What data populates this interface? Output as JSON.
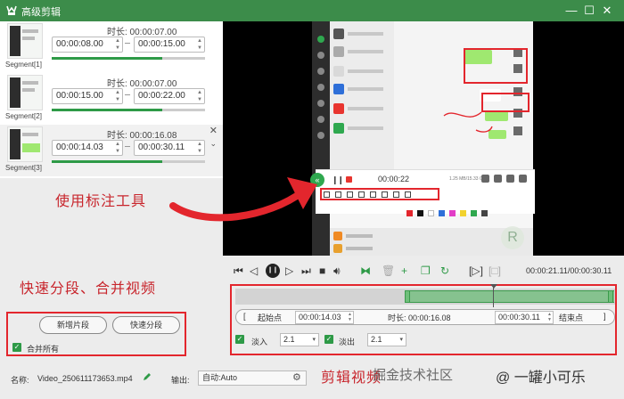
{
  "window": {
    "title": "高级剪辑"
  },
  "segments": [
    {
      "label": "Segment[1]",
      "duration": "时长: 00:00:07.00",
      "start": "00:00:08.00",
      "end": "00:00:15.00",
      "progress": 0.72
    },
    {
      "label": "Segment[2]",
      "duration": "时长: 00:00:07.00",
      "start": "00:00:15.00",
      "end": "00:00:22.00",
      "progress": 0.72
    },
    {
      "label": "Segment[3]",
      "duration": "时长: 00:00:16.08",
      "start": "00:00:14.03",
      "end": "00:00:30.11",
      "progress": 0.72
    }
  ],
  "preview": {
    "rec_time": "00:00:22",
    "rec_size": "1.25 MB/15.33 GB"
  },
  "annotations": {
    "tool": "使用标注工具",
    "split": "快速分段、合并视频",
    "edit": "剪辑视频"
  },
  "left_panel": {
    "add_segment": "新增片段",
    "quick_split": "快速分段",
    "merge_all": "合并所有"
  },
  "player": {
    "timecode": "00:00:21.11/00:00:30.11"
  },
  "edit": {
    "start_label": "起始点",
    "start_time": "00:00:14.03",
    "duration": "时长: 00:00:16.08",
    "end_time": "00:00:30.11",
    "end_label": "结束点",
    "fade_in_label": "淡入",
    "fade_in_value": "2.1",
    "fade_out_label": "淡出",
    "fade_out_value": "2.1"
  },
  "footer": {
    "name_label": "名称:",
    "name_value": "Video_250611173653.mp4",
    "output_label": "输出:",
    "output_value": "自动:Auto"
  },
  "watermark": {
    "text": "掘金技术社区",
    "author": "@ 一罐小可乐"
  },
  "colors": {
    "accent": "#3c8c4a",
    "highlight": "#e3262d"
  }
}
